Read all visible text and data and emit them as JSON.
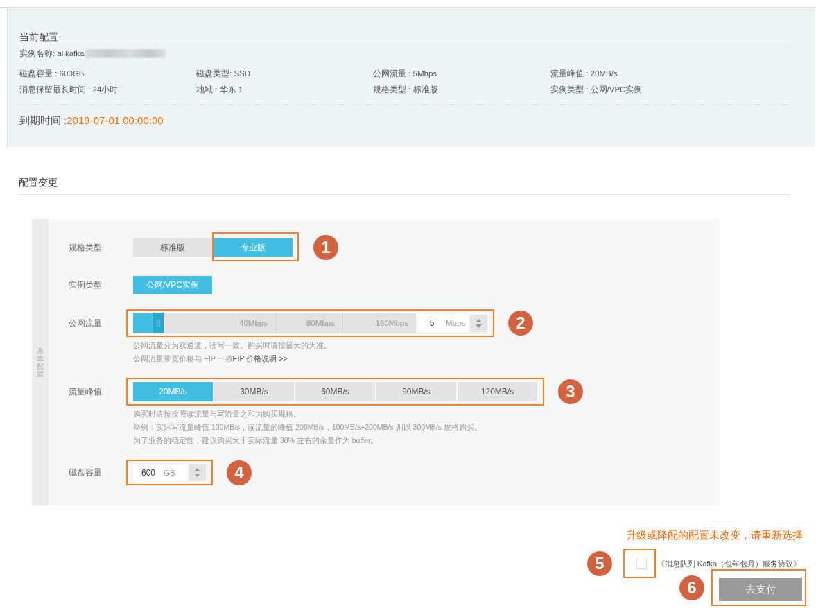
{
  "current_config": {
    "title": "当前配置",
    "instance_name": {
      "text": "实例名称: alikafka",
      "redacted": true
    },
    "fields": [
      {
        "text": "磁盘容量 : 600GB"
      },
      {
        "text": "磁盘类型: SSD"
      },
      {
        "text": "公网流量 : 5Mbps"
      },
      {
        "text": "流量峰值 : 20MB/s"
      },
      {
        "text": "消息保留最长时间 : 24小时"
      },
      {
        "text": "地域 : 华东 1"
      },
      {
        "text": "规格类型 : 标准版"
      },
      {
        "text": "实例类型 : 公网/VPC实例"
      }
    ],
    "expiry": {
      "label": "到期时间 :",
      "value": "2019-07-01 00:00:00"
    }
  },
  "change_config": {
    "title": "配置变更",
    "side_tab": "基本配置",
    "rows": [
      {
        "kind": "segmented",
        "label": "规格类型",
        "highlighted": false,
        "callout": "1",
        "options": [
          {
            "label": "标准版",
            "selected": false,
            "highlighted": false
          },
          {
            "label": "专业版",
            "selected": true,
            "highlighted": true
          }
        ]
      },
      {
        "kind": "segmented",
        "label": "实例类型",
        "highlighted": false,
        "options": [
          {
            "label": "公网/VPC实例",
            "selected": true,
            "highlighted": false
          }
        ]
      },
      {
        "kind": "slider",
        "label": "公网流量",
        "highlighted": true,
        "callout": "2",
        "level": 0.09,
        "ticks": [
          "40Mbps",
          "80Mbps",
          "160Mbps"
        ],
        "input": {
          "value": "5",
          "unit": "Mbps"
        },
        "notes": [
          {
            "text": "公网流量分为双通道，读写一致。购买时请按最大的为准。"
          },
          {
            "text": "公网流量带宽价格与 EIP 一致",
            "link": "EIP 价格说明 >>"
          }
        ]
      },
      {
        "kind": "segmented",
        "label": "流量峰值",
        "highlighted": true,
        "callout": "3",
        "options": [
          {
            "label": "20MB/s",
            "selected": true,
            "highlighted": false
          },
          {
            "label": "30MB/s",
            "selected": false,
            "highlighted": false
          },
          {
            "label": "60MB/s",
            "selected": false,
            "highlighted": false
          },
          {
            "label": "90MB/s",
            "selected": false,
            "highlighted": false
          },
          {
            "label": "120MB/s",
            "selected": false,
            "highlighted": false
          }
        ],
        "notes": [
          {
            "text": "购买时请按按照读流量与写流量之和为购买规格。"
          },
          {
            "text": "举例：实际写流量峰值 100MB/s，读流量的峰值 200MB/s，100MB/s+200MB/s 则以 300MB/s 规格购买。"
          },
          {
            "text": "为了业务的稳定性，建议购买大于实际流量 30% 左右的余量作为 buffer。"
          }
        ]
      },
      {
        "kind": "number",
        "label": "磁盘容量",
        "highlighted": true,
        "callout": "4",
        "input": {
          "value": "600",
          "unit": "GB"
        }
      }
    ]
  },
  "footer": {
    "warning": "升级或降配的配置未改变，请重新选择",
    "agreement": {
      "checked": false,
      "highlighted": true,
      "callout": "5",
      "text": "《消息队列 Kafka（包年包月）服务协议》"
    },
    "pay_button": {
      "label": "去支付",
      "disabled": true,
      "highlighted": true,
      "callout": "6"
    }
  }
}
